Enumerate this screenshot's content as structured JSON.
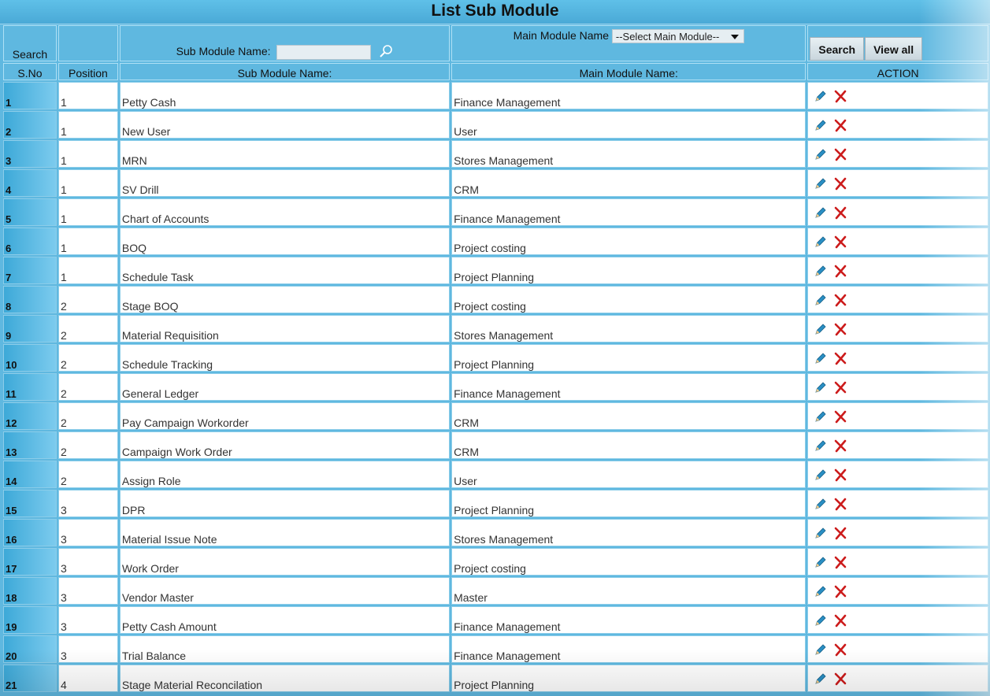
{
  "title": "List Sub Module",
  "search": {
    "label": "Search",
    "sub_module_label": "Sub Module Name:",
    "sub_module_value": "",
    "main_module_label": "Main Module Name",
    "main_module_selected": "--Select Main Module--",
    "search_button": "Search",
    "view_all_button": "View all"
  },
  "columns": {
    "sno": "S.No",
    "position": "Position",
    "sub_module": "Sub Module Name:",
    "main_module": "Main Module Name:",
    "action": "ACTION"
  },
  "icons": {
    "edit": "pencil-icon",
    "delete": "x-icon",
    "search": "magnifier-icon"
  },
  "colors": {
    "header_bg": "#5fb8e0",
    "row_bg": "#ffffff",
    "edit_icon": "#2a8fc4",
    "delete_icon": "#cc1b1b"
  },
  "rows": [
    {
      "sno": "1",
      "position": "1",
      "name": "Petty Cash",
      "main": "Finance Management"
    },
    {
      "sno": "2",
      "position": "1",
      "name": "New User",
      "main": "User"
    },
    {
      "sno": "3",
      "position": "1",
      "name": "MRN",
      "main": "Stores Management"
    },
    {
      "sno": "4",
      "position": "1",
      "name": "SV Drill",
      "main": "CRM"
    },
    {
      "sno": "5",
      "position": "1",
      "name": "Chart of Accounts",
      "main": "Finance Management"
    },
    {
      "sno": "6",
      "position": "1",
      "name": "BOQ",
      "main": "Project costing"
    },
    {
      "sno": "7",
      "position": "1",
      "name": "Schedule Task",
      "main": "Project Planning"
    },
    {
      "sno": "8",
      "position": "2",
      "name": "Stage BOQ",
      "main": "Project costing"
    },
    {
      "sno": "9",
      "position": "2",
      "name": "Material Requisition",
      "main": "Stores Management"
    },
    {
      "sno": "10",
      "position": "2",
      "name": "Schedule Tracking",
      "main": "Project Planning"
    },
    {
      "sno": "11",
      "position": "2",
      "name": "General Ledger",
      "main": "Finance Management"
    },
    {
      "sno": "12",
      "position": "2",
      "name": "Pay Campaign Workorder",
      "main": "CRM"
    },
    {
      "sno": "13",
      "position": "2",
      "name": "Campaign Work Order",
      "main": "CRM"
    },
    {
      "sno": "14",
      "position": "2",
      "name": "Assign Role",
      "main": "User"
    },
    {
      "sno": "15",
      "position": "3",
      "name": "DPR",
      "main": "Project Planning"
    },
    {
      "sno": "16",
      "position": "3",
      "name": "Material Issue Note",
      "main": "Stores Management"
    },
    {
      "sno": "17",
      "position": "3",
      "name": "Work Order",
      "main": "Project costing"
    },
    {
      "sno": "18",
      "position": "3",
      "name": "Vendor Master",
      "main": "Master"
    },
    {
      "sno": "19",
      "position": "3",
      "name": "Petty Cash Amount",
      "main": "Finance Management"
    },
    {
      "sno": "20",
      "position": "3",
      "name": "Trial Balance",
      "main": "Finance Management"
    },
    {
      "sno": "21",
      "position": "4",
      "name": "Stage Material Reconcilation",
      "main": "Project Planning"
    }
  ]
}
